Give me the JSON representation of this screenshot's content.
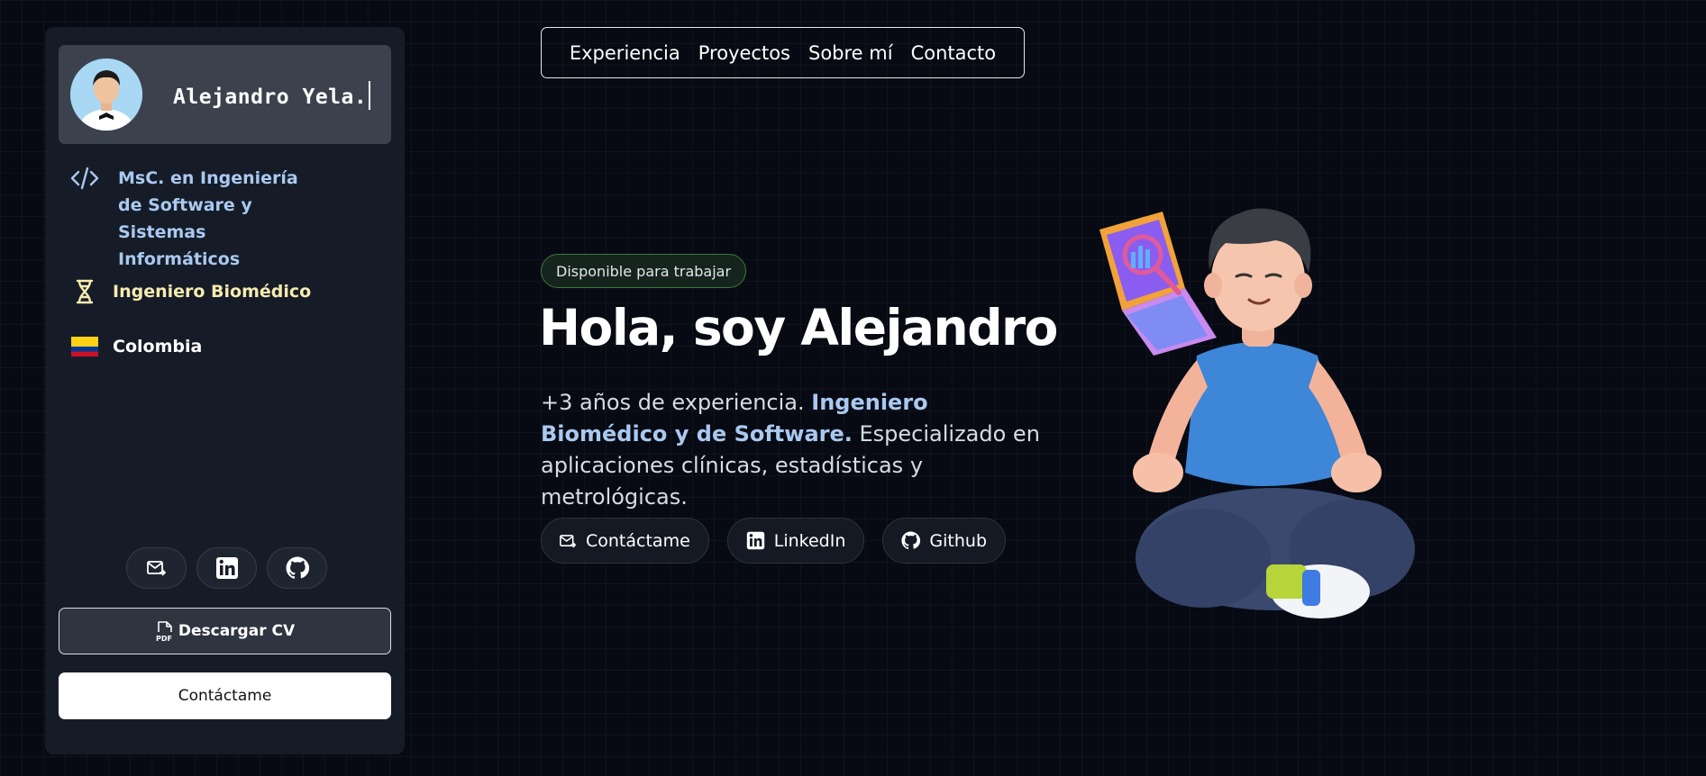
{
  "sidebar": {
    "name": "Alejandro Yela.",
    "items": [
      {
        "label": "MsC. en Ingeniería de Software y Sistemas Informáticos",
        "icon": "code-icon"
      },
      {
        "label": "Ingeniero Biomédico",
        "icon": "dna-icon"
      },
      {
        "label": "Colombia",
        "icon": "colombia-flag-icon"
      }
    ],
    "social": [
      "mail-icon",
      "linkedin-icon",
      "github-icon"
    ],
    "cv_button": "Descargar CV",
    "contact_button": "Contáctame"
  },
  "nav": {
    "items": [
      "Experiencia",
      "Proyectos",
      "Sobre mí",
      "Contacto"
    ]
  },
  "hero": {
    "badge": "Disponible para trabajar",
    "title": "Hola, soy Alejandro",
    "desc_prefix": "+3 años de experiencia. ",
    "desc_highlight": "Ingeniero Biomédico y de Software.",
    "desc_suffix": " Especializado en aplicaciones clínicas, estadísticas y metrológicas.",
    "buttons": [
      {
        "label": "Contáctame",
        "icon": "mail-icon"
      },
      {
        "label": "LinkedIn",
        "icon": "linkedin-icon"
      },
      {
        "label": "Github",
        "icon": "github-icon"
      }
    ]
  },
  "colors": {
    "background": "#070a13",
    "sidebar": "#161c27",
    "accent_blue": "#a9c9f0",
    "accent_yellow": "#f6ecb0",
    "badge_border": "#3c7a37"
  }
}
